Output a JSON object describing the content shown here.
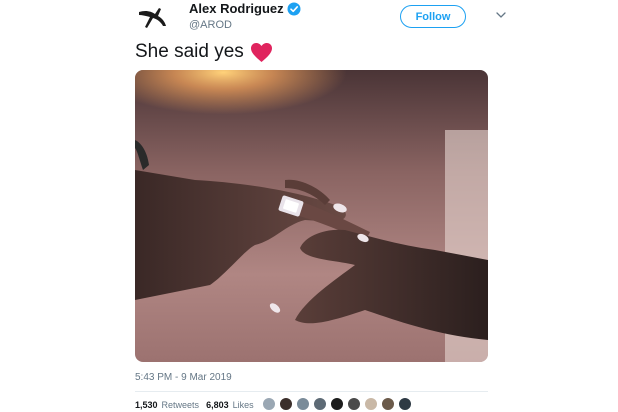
{
  "user": {
    "display_name": "Alex Rodriguez",
    "handle": "@AROD",
    "avatar_icon": "arod-logo-icon",
    "verified_icon": "verified-badge-icon",
    "verified_color": "#1da1f2"
  },
  "header": {
    "follow_label": "Follow",
    "more_icon": "chevron-down-icon"
  },
  "tweet": {
    "text": "She said yes",
    "emoji_icon": "red-heart-icon",
    "heart_color": "#e0245e",
    "timestamp": "5:43 PM - 9 Mar 2019"
  },
  "stats": {
    "retweets_count": "1,530",
    "retweets_label": "Retweets",
    "likes_count": "6,803",
    "likes_label": "Likes"
  },
  "likers": [
    {
      "name": "liker-avatar-1",
      "color": "#9aa7b3"
    },
    {
      "name": "liker-avatar-2",
      "color": "#3b2f2b"
    },
    {
      "name": "liker-avatar-3",
      "color": "#7a8b99"
    },
    {
      "name": "liker-avatar-4",
      "color": "#5d6a75"
    },
    {
      "name": "liker-avatar-5",
      "color": "#1c1c1c"
    },
    {
      "name": "liker-avatar-6",
      "color": "#4a4a4a"
    },
    {
      "name": "liker-avatar-7",
      "color": "#c9b8a6"
    },
    {
      "name": "liker-avatar-8",
      "color": "#6b5a4a"
    },
    {
      "name": "liker-avatar-9",
      "color": "#2e3a44"
    }
  ],
  "colors": {
    "accent": "#1da1f2",
    "muted_text": "#657786",
    "primary_text": "#14171a"
  }
}
